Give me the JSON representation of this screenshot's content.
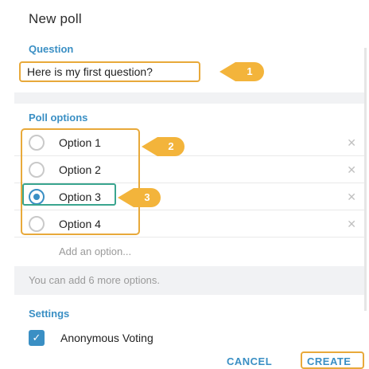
{
  "dialog": {
    "title": "New poll"
  },
  "question": {
    "label": "Question",
    "value": "Here is my first question?"
  },
  "poll_options": {
    "label": "Poll options",
    "options": [
      {
        "label": "Option 1",
        "selected": false
      },
      {
        "label": "Option 2",
        "selected": false
      },
      {
        "label": "Option 3",
        "selected": true
      },
      {
        "label": "Option 4",
        "selected": false
      }
    ],
    "add_placeholder": "Add an option...",
    "hint": "You can add 6 more options."
  },
  "settings": {
    "label": "Settings",
    "anonymous_voting": {
      "label": "Anonymous Voting",
      "checked": true
    }
  },
  "footer": {
    "cancel_label": "CANCEL",
    "create_label": "CREATE"
  },
  "callouts": [
    "1",
    "2",
    "3"
  ],
  "colors": {
    "accent": "#3a8fc4",
    "highlight": "#e8a93a",
    "highlight_alt": "#3aa58f"
  }
}
